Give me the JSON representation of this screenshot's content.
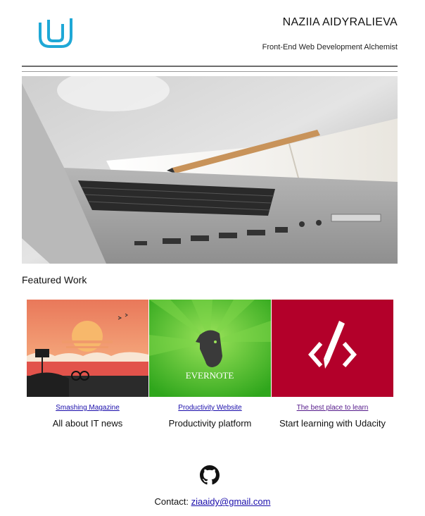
{
  "header": {
    "name": "NAZIIA AIDYRALIEVA",
    "tagline": "Front-End Web Development Alchemist",
    "logo_icon": "udacity-logo-icon",
    "logo_color": "#1fa8d6"
  },
  "featured": {
    "title": "Featured Work",
    "cards": [
      {
        "link": "Smashing Magazine",
        "description": "All about IT news",
        "image": "smashing-magazine-sunset-illustration"
      },
      {
        "link": "Productivity Website",
        "description": "Productivity platform",
        "image": "evernote-elephant-logo",
        "image_text": "EVERNOTE"
      },
      {
        "link": "The best place to learn",
        "description": "Start learning with Udacity",
        "image": "code-pencil-icon"
      }
    ]
  },
  "footer": {
    "icon": "github-icon",
    "contact_label": "Contact:",
    "email": "ziaaidy@gmail.com"
  },
  "colors": {
    "link": "#1a0dab",
    "visited_link": "#551a8b",
    "evernote_green": "#3fb92b",
    "udacity_red": "#b3002a",
    "sunset_orange": "#ef8a5f"
  }
}
